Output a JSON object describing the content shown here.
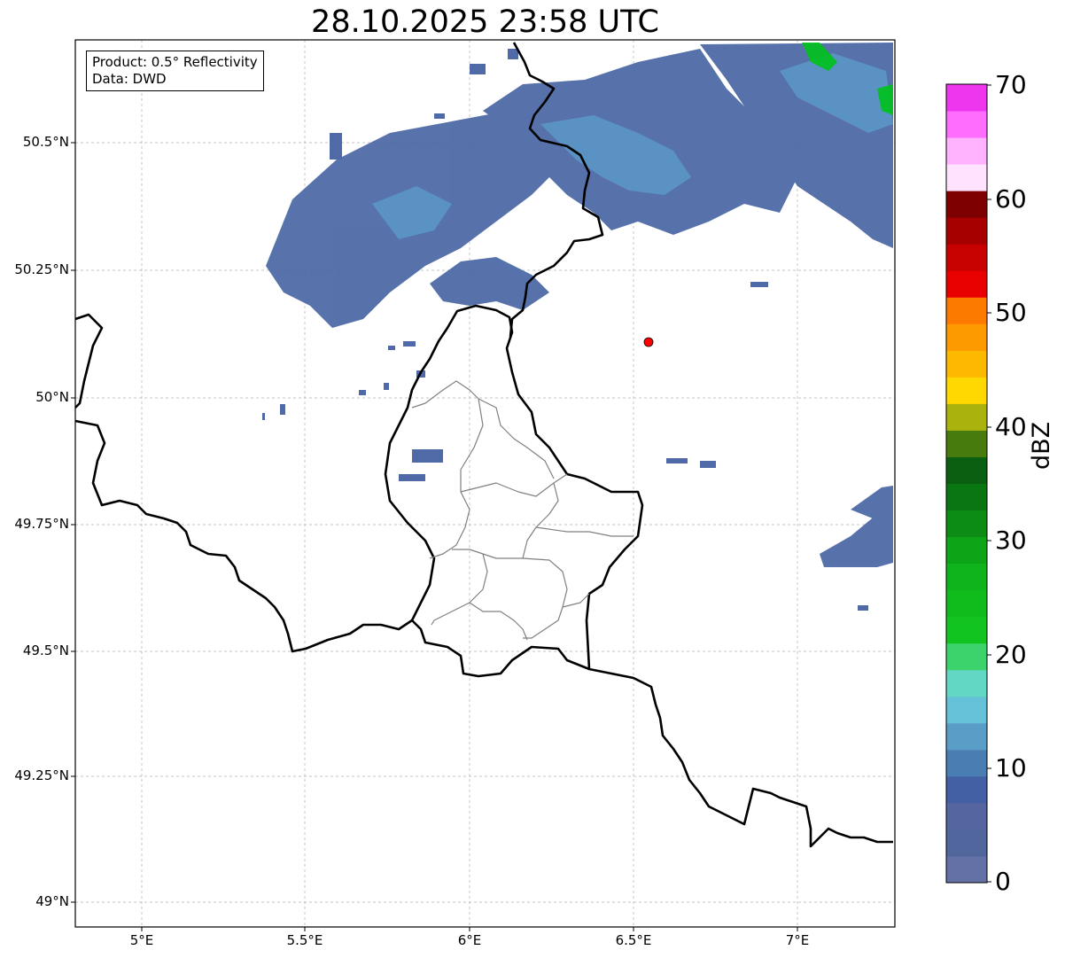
{
  "title": "28.10.2025 23:58 UTC",
  "info_box": {
    "product": "Product: 0.5° Reflectivity",
    "data": "Data: DWD"
  },
  "map": {
    "lat_labels": [
      "50.5°N",
      "50.25°N",
      "50°N",
      "49.75°N",
      "49.5°N",
      "49.25°N",
      "49°N"
    ],
    "lon_labels": [
      "5°E",
      "5.5°E",
      "6°E",
      "6.5°E",
      "7°E"
    ],
    "gridline_color": "#b0b0b0",
    "border_color": "#000000",
    "district_color": "#808080",
    "radar_site_color": "#ff0000",
    "echo_colors": [
      "#4f6aa6",
      "#5b8ec4",
      "#62c6c8",
      "#00c21c"
    ]
  },
  "colorbar": {
    "label": "dBZ",
    "ticks": [
      "70",
      "60",
      "50",
      "40",
      "30",
      "20",
      "10",
      "0"
    ],
    "colors_bottom_to_top": [
      "#6471a6",
      "#51669c",
      "#5465a0",
      "#4460a4",
      "#4a7db2",
      "#5a9dc7",
      "#65c1d8",
      "#62d7c4",
      "#3cd36c",
      "#12c41f",
      "#0fbc1c",
      "#0fb31b",
      "#0ea418",
      "#0c8c14",
      "#0a7612",
      "#0a5e10",
      "#477b0e",
      "#aab20d",
      "#fed800",
      "#fdb900",
      "#fc9a00",
      "#fd7a00",
      "#e80000",
      "#c70000",
      "#a60000",
      "#7e0000",
      "#ffe2fe",
      "#ffb3fe",
      "#ff6dfe",
      "#ee36ef"
    ]
  }
}
